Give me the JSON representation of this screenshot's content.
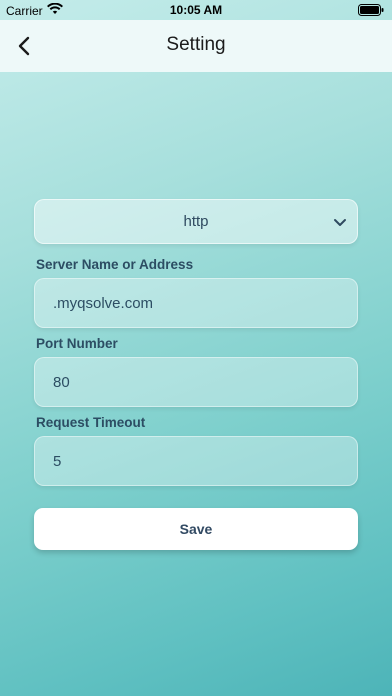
{
  "status_bar": {
    "carrier": "Carrier",
    "time": "10:05 AM"
  },
  "header": {
    "title": "Setting"
  },
  "protocol": {
    "selected": "http"
  },
  "fields": {
    "server_label": "Server Name or Address",
    "server_value": ".myqsolve.com",
    "port_label": "Port Number",
    "port_value": "80",
    "timeout_label": "Request Timeout",
    "timeout_value": "5"
  },
  "actions": {
    "save_label": "Save"
  },
  "colors": {
    "accent_text": "#2c4d63",
    "background_top": "#c4ecea",
    "background_bottom": "#4db4b8"
  }
}
